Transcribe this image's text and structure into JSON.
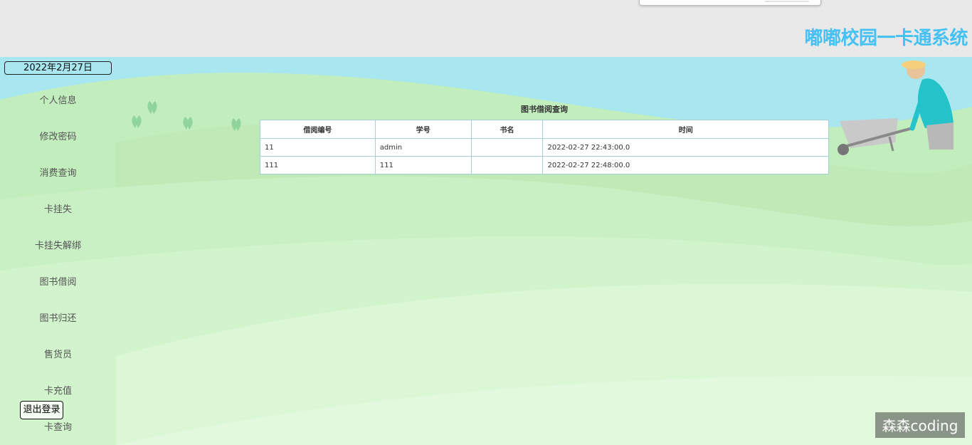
{
  "app": {
    "title": "嘟嘟校园一卡通系统"
  },
  "sidebar": {
    "date": "2022年2月27日",
    "items": [
      {
        "label": "个人信息"
      },
      {
        "label": "修改密码"
      },
      {
        "label": "消费查询"
      },
      {
        "label": "卡挂失"
      },
      {
        "label": "卡挂失解绑"
      },
      {
        "label": "图书借阅"
      },
      {
        "label": "图书归还"
      },
      {
        "label": "售货员"
      },
      {
        "label": "卡充值"
      },
      {
        "label": "卡查询"
      }
    ],
    "logout_label": "退出登录"
  },
  "main": {
    "table_title": "图书借阅查询",
    "columns": [
      "借阅编号",
      "学号",
      "书名",
      "时间"
    ],
    "rows": [
      [
        "11",
        "admin",
        "",
        "2022-02-27 22:43:00.0"
      ],
      [
        "111",
        "111",
        "",
        "2022-02-27 22:48:00.0"
      ]
    ]
  },
  "watermark": "森森coding",
  "colors": {
    "title": "#45c1f3",
    "sky": "#a8e7ef",
    "hill": "#c8f0c2"
  }
}
